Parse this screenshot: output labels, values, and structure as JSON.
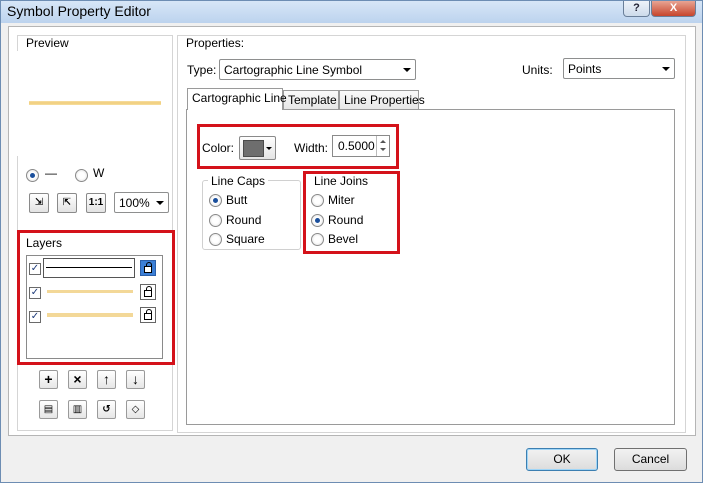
{
  "window": {
    "title": "Symbol Property Editor",
    "help_label": "?",
    "close_label": "X"
  },
  "preview": {
    "label": "Preview",
    "line_style_options": [
      "—",
      "W"
    ],
    "selected_line_style": "—",
    "zoom": "100%",
    "tool_icons": [
      "zoom-in-icon",
      "zoom-out-icon",
      "one-to-one-icon"
    ],
    "tool_labels": [
      "⇲",
      "⇱",
      "1:1"
    ]
  },
  "layers": {
    "label": "Layers",
    "items": [
      {
        "checked": true,
        "locked": true,
        "selected": true
      },
      {
        "checked": true,
        "locked": true,
        "selected": false
      },
      {
        "checked": true,
        "locked": true,
        "selected": false
      }
    ],
    "buttons": [
      "+",
      "×",
      "↑",
      "↓"
    ],
    "button_icons": [
      "add-layer-icon",
      "remove-layer-icon",
      "move-up-icon",
      "move-down-icon"
    ],
    "bottom_button_icons": [
      "copy-icon",
      "paste-icon",
      "reset-icon",
      "tag-icon"
    ]
  },
  "properties": {
    "label": "Properties:",
    "type_label": "Type:",
    "type_value": "Cartographic Line Symbol",
    "units_label": "Units:",
    "units_value": "Points",
    "tabs": [
      "Cartographic Line",
      "Template",
      "Line Properties"
    ],
    "active_tab": "Cartographic Line",
    "color_label": "Color:",
    "color_value": "#6e6e6e",
    "width_label": "Width:",
    "width_value": "0.5000",
    "line_caps": {
      "label": "Line Caps",
      "options": [
        "Butt",
        "Round",
        "Square"
      ],
      "selected": "Butt"
    },
    "line_joins": {
      "label": "Line Joins",
      "options": [
        "Miter",
        "Round",
        "Bevel"
      ],
      "selected": "Round"
    }
  },
  "footer": {
    "ok_label": "OK",
    "cancel_label": "Cancel"
  },
  "colors": {
    "highlight_red": "#d4121a",
    "line_symbol": "#f0cd7a"
  }
}
